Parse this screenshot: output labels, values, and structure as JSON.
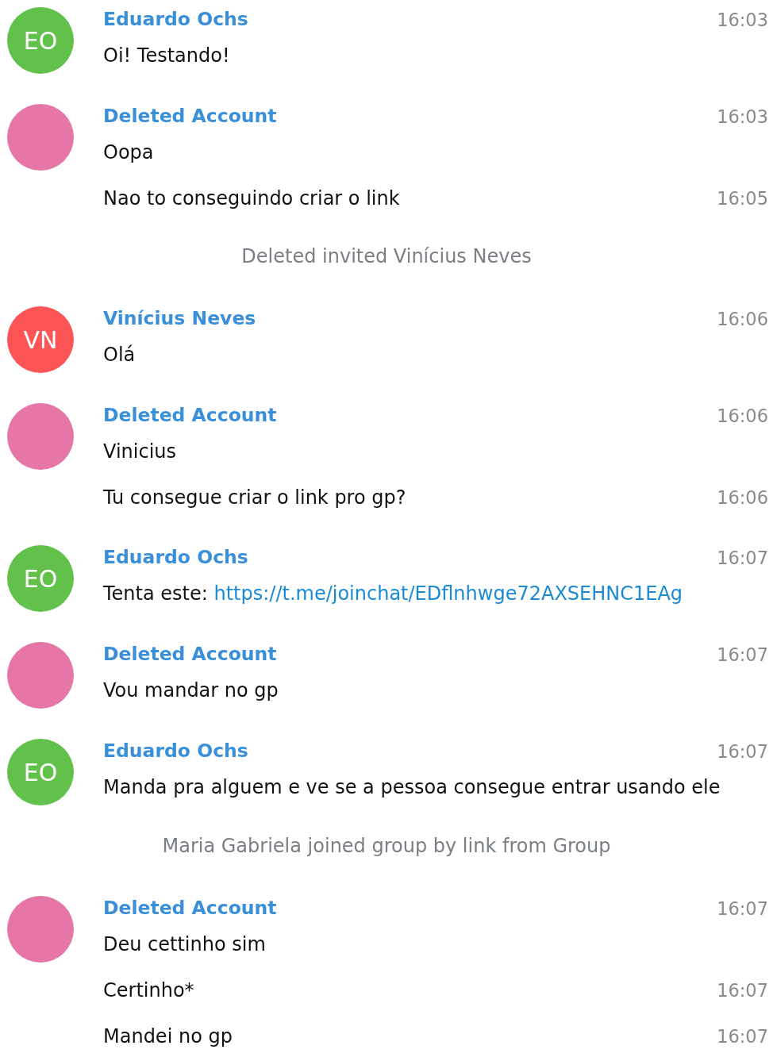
{
  "feed": [
    {
      "kind": "group",
      "sender": "Eduardo Ochs",
      "initials": "EO",
      "color": "#62c14a",
      "messages": [
        {
          "text": "Oi! Testando!",
          "time": "16:03"
        }
      ]
    },
    {
      "kind": "group",
      "sender": "Deleted Account",
      "color": "#e676a6",
      "messages": [
        {
          "text": "Oopa",
          "time": "16:03"
        },
        {
          "text": "Nao to conseguindo criar o link",
          "time": "16:05"
        }
      ]
    },
    {
      "kind": "service",
      "text": "Deleted invited Vinícius Neves"
    },
    {
      "kind": "group",
      "sender": "Vinícius Neves",
      "initials": "VN",
      "color": "#fd5455",
      "messages": [
        {
          "text": "Olá",
          "time": "16:06"
        }
      ]
    },
    {
      "kind": "group",
      "sender": "Deleted Account",
      "color": "#e676a6",
      "messages": [
        {
          "text": "Vinicius",
          "time": "16:06"
        },
        {
          "text": "Tu consegue criar o link pro gp?",
          "time": "16:06"
        }
      ]
    },
    {
      "kind": "group",
      "sender": "Eduardo Ochs",
      "initials": "EO",
      "color": "#62c14a",
      "messages": [
        {
          "text": "Tenta este: ",
          "link": "https://t.me/joinchat/EDflnhwge72AXSEHNC1EAg",
          "time": "16:07"
        }
      ]
    },
    {
      "kind": "group",
      "sender": "Deleted Account",
      "color": "#e676a6",
      "messages": [
        {
          "text": "Vou mandar no gp",
          "time": "16:07"
        }
      ]
    },
    {
      "kind": "group",
      "sender": "Eduardo Ochs",
      "initials": "EO",
      "color": "#62c14a",
      "messages": [
        {
          "text": "Manda pra alguem e ve se a pessoa consegue entrar usando ele",
          "time": "16:07"
        }
      ]
    },
    {
      "kind": "service",
      "text": "Maria Gabriela joined group by link from Group"
    },
    {
      "kind": "group",
      "sender": "Deleted Account",
      "color": "#e676a6",
      "messages": [
        {
          "text": "Deu cettinho sim",
          "time": "16:07"
        },
        {
          "text": "Certinho*",
          "time": "16:07"
        },
        {
          "text": "Mandei no gp",
          "time": "16:07"
        }
      ]
    }
  ]
}
